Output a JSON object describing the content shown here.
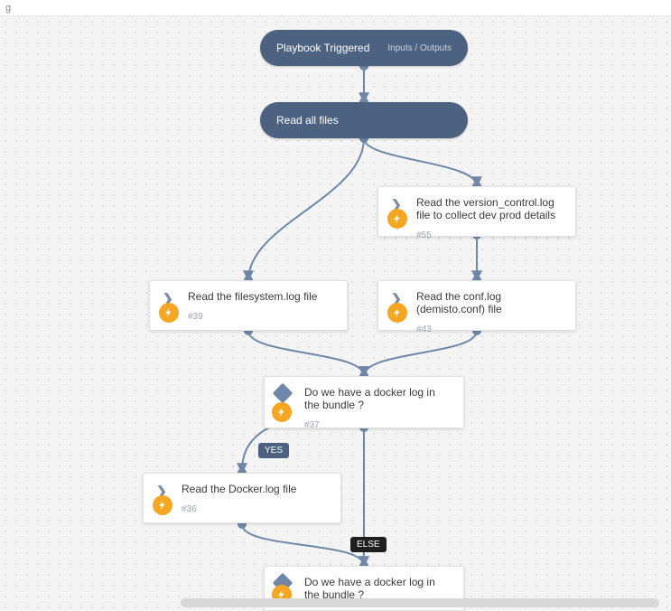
{
  "header": {
    "crumb": "g"
  },
  "trigger": {
    "label": "Playbook Triggered",
    "io": "Inputs / Outputs"
  },
  "section": {
    "label": "Read all files"
  },
  "tasks": {
    "version": {
      "title": "Read the version_control.log file to collect dev prod details",
      "id": "#55"
    },
    "filesystem": {
      "title": "Read the filesystem.log file",
      "id": "#39"
    },
    "conf": {
      "title": "Read the conf.log (demisto.conf) file",
      "id": "#43"
    },
    "docker": {
      "title": "Read the Docker.log file",
      "id": "#36"
    }
  },
  "conds": {
    "docker1": {
      "title": "Do we have a docker log in the bundle ?",
      "id": "#37"
    },
    "docker2": {
      "title": "Do we have a docker log in the bundle ?",
      "id": ""
    }
  },
  "branches": {
    "yes": "YES",
    "else": "ELSE"
  }
}
